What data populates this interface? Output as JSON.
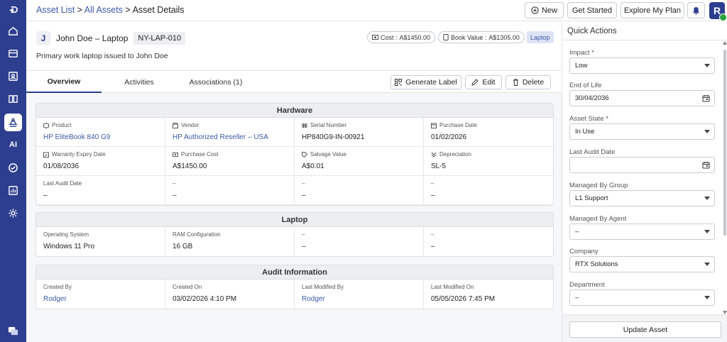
{
  "breadcrumb": {
    "asset_list": "Asset List",
    "sep1": ">",
    "all_assets": "All Assets",
    "sep2": ">",
    "current": "Asset Details"
  },
  "header": {
    "new_label": "New",
    "get_started_label": "Get Started",
    "explore_label": "Explore My Plan",
    "avatar_initial": "R"
  },
  "nav": {
    "ai_label": "AI",
    "icons": [
      "logout-icon",
      "home-icon",
      "ticket-icon",
      "contact-icon",
      "knowledge-icon",
      "assets-icon",
      "ai-icon",
      "tasks-icon",
      "reports-icon",
      "settings-icon",
      "chat-icon"
    ],
    "active": "assets-icon"
  },
  "asset": {
    "avatar_initial": "J",
    "name": "John Doe – Laptop",
    "tag": "NY-LAP-010",
    "cost_label": "Cost :",
    "cost_value": "A$1450.00",
    "book_value_label": "Book Value :",
    "book_value": "A$1305.00",
    "type": "Laptop",
    "description": "Primary work laptop issued to John Doe"
  },
  "tabs": [
    {
      "label": "Overview",
      "active": true
    },
    {
      "label": "Activities",
      "active": false
    },
    {
      "label": "Associations (1)",
      "active": false
    }
  ],
  "actions": {
    "generate_label": "Generate Label",
    "edit": "Edit",
    "delete": "Delete"
  },
  "sections": {
    "hardware": {
      "title": "Hardware",
      "cells": [
        {
          "label": "Product",
          "value": "HP EliteBook 840 G9",
          "link": true,
          "icon": "box-icon"
        },
        {
          "label": "Vendor",
          "value": "HP Authorized Reseller – USA",
          "link": true,
          "icon": "vendor-icon"
        },
        {
          "label": "Serial Number",
          "value": "HP840G9-IN-00921",
          "link": false,
          "icon": "barcode-icon"
        },
        {
          "label": "Purchase Date",
          "value": "01/02/2026",
          "link": false,
          "icon": "calendar-icon"
        },
        {
          "label": "Warranty Expiry Date",
          "value": "01/08/2036",
          "link": false,
          "icon": "warranty-icon"
        },
        {
          "label": "Purchase Cost",
          "value": "A$1450.00",
          "link": false,
          "icon": "money-icon"
        },
        {
          "label": "Salvage Value",
          "value": "A$0.01",
          "link": false,
          "icon": "tag-icon"
        },
        {
          "label": "Depreciation",
          "value": "SL-5",
          "link": false,
          "icon": "depreciation-icon"
        },
        {
          "label": "Last Audit Date",
          "value": "–",
          "link": false,
          "icon": ""
        },
        {
          "label": "–",
          "value": "–",
          "link": false,
          "icon": ""
        },
        {
          "label": "–",
          "value": "–",
          "link": false,
          "icon": ""
        },
        {
          "label": "–",
          "value": "–",
          "link": false,
          "icon": ""
        }
      ]
    },
    "laptop": {
      "title": "Laptop",
      "cells": [
        {
          "label": "Operating System",
          "value": "Windows 11 Pro",
          "link": false
        },
        {
          "label": "RAM Configuration",
          "value": "16 GB",
          "link": false
        },
        {
          "label": "–",
          "value": "–",
          "link": false
        },
        {
          "label": "–",
          "value": "–",
          "link": false
        }
      ]
    },
    "audit": {
      "title": "Audit Information",
      "cells": [
        {
          "label": "Created By",
          "value": "Rodger",
          "link": true
        },
        {
          "label": "Created On",
          "value": "03/02/2026 4:10 PM",
          "link": false
        },
        {
          "label": "Last Modified By",
          "value": "Rodger",
          "link": true
        },
        {
          "label": "Last Modified On",
          "value": "05/05/2026 7:45 PM",
          "link": false
        }
      ]
    }
  },
  "quick_actions": {
    "title": "Quick Actions",
    "fields": [
      {
        "label": "Impact *",
        "value": "Low",
        "type": "select"
      },
      {
        "label": "End of Life",
        "value": "30/04/2036",
        "type": "date"
      },
      {
        "label": "Asset State *",
        "value": "In Use",
        "type": "select"
      },
      {
        "label": "Last Audit Date",
        "value": "",
        "type": "date"
      },
      {
        "label": "Managed By Group",
        "value": "L1 Support",
        "type": "select"
      },
      {
        "label": "Managed By Agent",
        "value": "–",
        "type": "select"
      },
      {
        "label": "Company",
        "value": "RTX Solutions",
        "type": "select"
      },
      {
        "label": "Department",
        "value": "–",
        "type": "select"
      }
    ],
    "update_label": "Update Asset"
  }
}
